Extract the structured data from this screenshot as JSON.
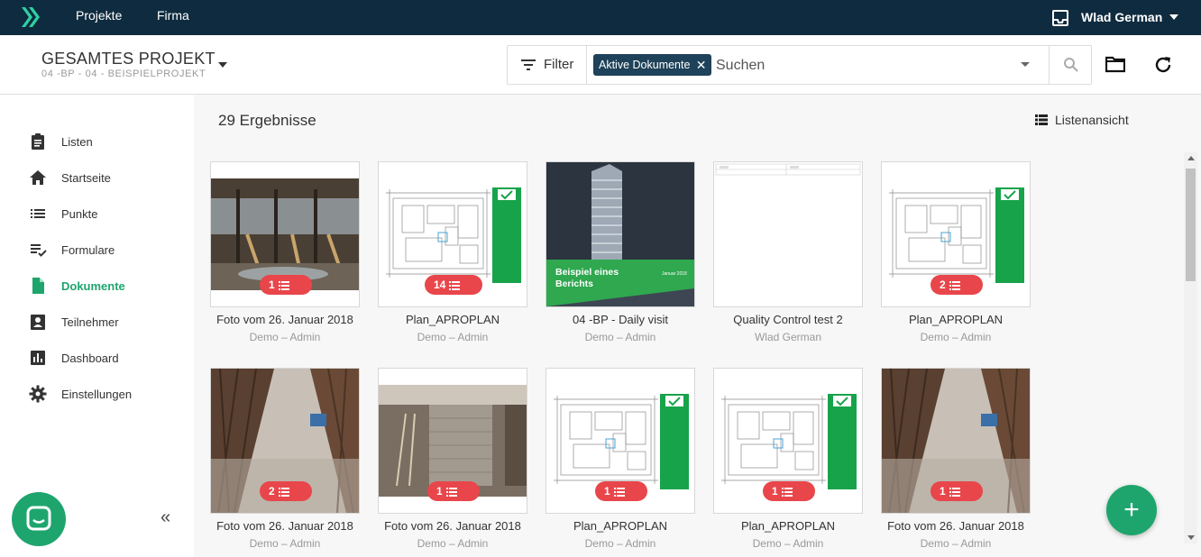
{
  "topbar": {
    "nav": [
      "Projekte",
      "Firma"
    ],
    "user_name": "Wlad German"
  },
  "header": {
    "project_title": "GESAMTES PROJEKT",
    "project_sub": "04 -BP - 04 - BEISPIELPROJEKT",
    "filter_label": "Filter",
    "chip_label": "Aktive Dokumente",
    "search_placeholder": "Suchen"
  },
  "sidebar": {
    "items": [
      {
        "label": "Listen",
        "icon": "clipboard-icon"
      },
      {
        "label": "Startseite",
        "icon": "home-icon"
      },
      {
        "label": "Punkte",
        "icon": "list-icon"
      },
      {
        "label": "Formulare",
        "icon": "checklist-icon"
      },
      {
        "label": "Dokumente",
        "icon": "document-icon",
        "active": true
      },
      {
        "label": "Teilnehmer",
        "icon": "contact-icon"
      },
      {
        "label": "Dashboard",
        "icon": "bar-chart-icon"
      },
      {
        "label": "Einstellungen",
        "icon": "gear-icon"
      }
    ]
  },
  "main": {
    "results": "29 Ergebnisse",
    "view_toggle": "Listenansicht",
    "documents": [
      {
        "title": "Foto vom 26. Januar 2018",
        "sub": "Demo – Admin",
        "badge": "1",
        "thumb": "photo-roof"
      },
      {
        "title": "Plan_APROPLAN",
        "sub": "Demo – Admin",
        "badge": "14",
        "thumb": "plan"
      },
      {
        "title": "04 -BP - Daily visit",
        "sub": "Demo – Admin",
        "badge": "",
        "thumb": "report",
        "report_title": "Beispiel eines Berichts",
        "report_date": "Januar 2018"
      },
      {
        "title": "Quality Control test 2",
        "sub": "Wlad German",
        "badge": "",
        "thumb": "form"
      },
      {
        "title": "Plan_APROPLAN",
        "sub": "Demo – Admin",
        "badge": "2",
        "thumb": "plan"
      },
      {
        "title": "Foto vom 26. Januar 2018",
        "sub": "Demo – Admin",
        "badge": "2",
        "thumb": "photo-rebar"
      },
      {
        "title": "Foto vom 26. Januar 2018",
        "sub": "Demo – Admin",
        "badge": "1",
        "thumb": "photo-brick"
      },
      {
        "title": "Plan_APROPLAN",
        "sub": "Demo – Admin",
        "badge": "1",
        "thumb": "plan"
      },
      {
        "title": "Plan_APROPLAN",
        "sub": "Demo – Admin",
        "badge": "1",
        "thumb": "plan"
      },
      {
        "title": "Foto vom 26. Januar 2018",
        "sub": "Demo – Admin",
        "badge": "1",
        "thumb": "photo-rebar"
      }
    ]
  },
  "colors": {
    "topbar": "#0f2b3f",
    "accent": "#1ea56e",
    "badge": "#e8464b",
    "chip": "#1e4259"
  }
}
